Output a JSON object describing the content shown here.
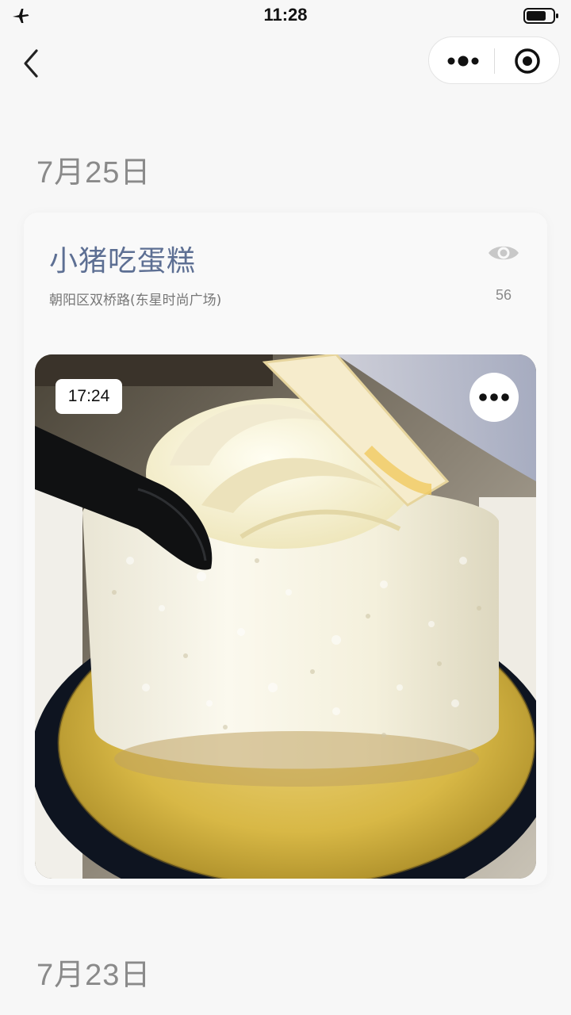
{
  "status_bar": {
    "time": "11:28",
    "airplane_icon": "airplane-icon",
    "battery_icon": "battery-icon"
  },
  "nav": {
    "back_icon": "chevron-left-icon",
    "more_icon": "more-dots-icon",
    "close_icon": "target-circle-icon"
  },
  "entries": [
    {
      "date": "7月25日",
      "title": "小猪吃蛋糕",
      "location": "朝阳区双桥路(东星时尚广场)",
      "views": "56",
      "view_icon": "eye-icon",
      "photo": {
        "time": "17:24",
        "description_icon": "photo-more-icon"
      }
    },
    {
      "date": "7月23日"
    }
  ],
  "colors": {
    "background": "#f7f7f7",
    "title": "#5d6f93",
    "date": "#8a8a8a"
  }
}
